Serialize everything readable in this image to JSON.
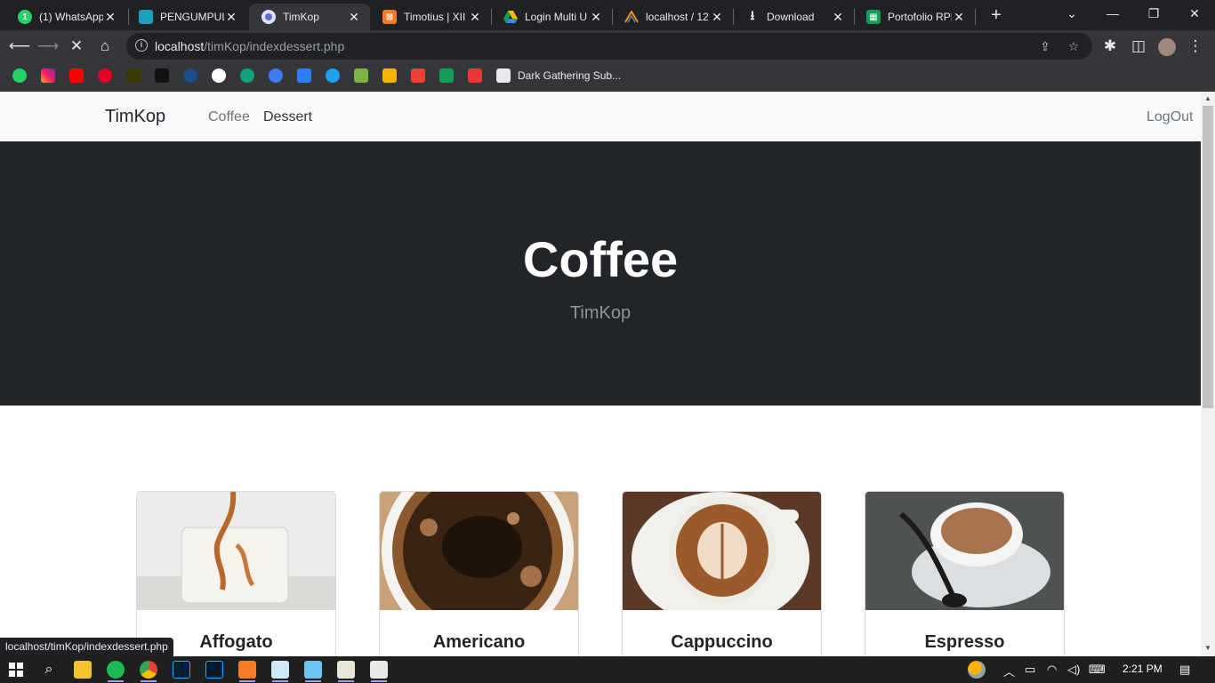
{
  "browser": {
    "tabs": [
      {
        "title": "(1) WhatsApp",
        "favicon": "whatsapp-icon",
        "color": "#25d366"
      },
      {
        "title": "PENGUMPUL",
        "favicon": "classroom-icon",
        "color": "#1a9fbf"
      },
      {
        "title": "TimKop",
        "favicon": "timkop-icon",
        "color": "#5b6fd6",
        "active": true
      },
      {
        "title": "Timotius | XII",
        "favicon": "xampp-icon",
        "color": "#fb7a24"
      },
      {
        "title": "Login Multi U",
        "favicon": "drive-icon",
        "color": "#fbbc04"
      },
      {
        "title": "localhost / 12",
        "favicon": "phpmyadmin-icon",
        "color": "#f29111"
      },
      {
        "title": "Download",
        "favicon": "download-icon",
        "color": "#e8eaed"
      },
      {
        "title": "Portofolio RPL",
        "favicon": "sheets-icon",
        "color": "#0f9d58"
      }
    ],
    "url_host": "localhost",
    "url_path": "/timKop/indexdessert.php",
    "bookmark_label": "Dark Gathering Sub...",
    "status_url": "localhost/timKop/indexdessert.php"
  },
  "site": {
    "brand": "TimKop",
    "nav": [
      "Coffee",
      "Dessert"
    ],
    "logout": "LogOut",
    "hero_title": "Coffee",
    "hero_subtitle": "TimKop",
    "products": [
      "Affogato",
      "Americano",
      "Cappuccino",
      "Espresso"
    ]
  },
  "taskbar": {
    "time": "2:21 PM"
  }
}
